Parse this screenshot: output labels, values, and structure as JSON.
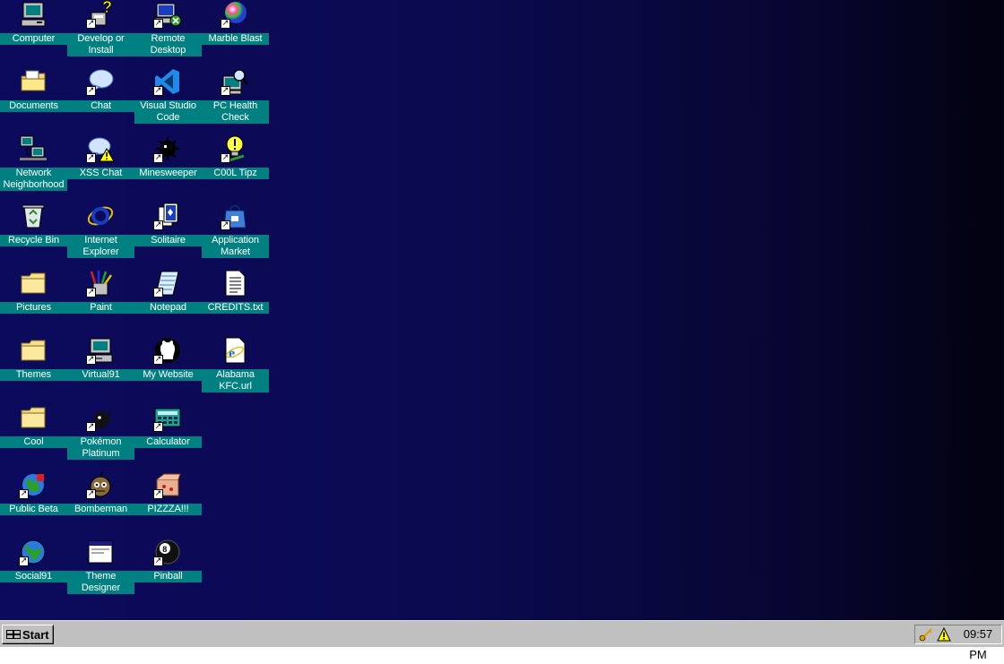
{
  "desktop": {
    "icons": [
      {
        "label": "Computer",
        "icon": "computer-icon",
        "shortcut": false
      },
      {
        "label": "Develop or Install",
        "icon": "develop-install-icon",
        "shortcut": true
      },
      {
        "label": "Remote Desktop",
        "icon": "remote-desktop-icon",
        "shortcut": true
      },
      {
        "label": "Marble Blast",
        "icon": "marble-icon",
        "shortcut": true
      },
      {
        "label": "Documents",
        "icon": "documents-folder-icon",
        "shortcut": false
      },
      {
        "label": "Chat",
        "icon": "chat-bubble-icon",
        "shortcut": true
      },
      {
        "label": "Visual Studio Code",
        "icon": "vscode-icon",
        "shortcut": true
      },
      {
        "label": "PC Health Check",
        "icon": "pc-health-icon",
        "shortcut": true
      },
      {
        "label": "Network Neighborhood",
        "icon": "network-icon",
        "shortcut": false
      },
      {
        "label": "XSS Chat",
        "icon": "xss-chat-icon",
        "shortcut": true
      },
      {
        "label": "Minesweeper",
        "icon": "mine-icon",
        "shortcut": true
      },
      {
        "label": "C00L Tipz",
        "icon": "tips-icon",
        "shortcut": true
      },
      {
        "label": "Recycle Bin",
        "icon": "recycle-bin-icon",
        "shortcut": false
      },
      {
        "label": "Internet Explorer",
        "icon": "internet-explorer-icon",
        "shortcut": false
      },
      {
        "label": "Solitaire",
        "icon": "solitaire-icon",
        "shortcut": true
      },
      {
        "label": "Application Market",
        "icon": "app-market-icon",
        "shortcut": true
      },
      {
        "label": "Pictures",
        "icon": "folder-icon",
        "shortcut": false
      },
      {
        "label": "Paint",
        "icon": "paint-icon",
        "shortcut": true
      },
      {
        "label": "Notepad",
        "icon": "notepad-icon",
        "shortcut": true
      },
      {
        "label": "CREDITS.txt",
        "icon": "text-file-icon",
        "shortcut": false
      },
      {
        "label": "Themes",
        "icon": "folder-icon",
        "shortcut": false
      },
      {
        "label": "Virtual91",
        "icon": "virtual-computer-icon",
        "shortcut": true
      },
      {
        "label": "My Website",
        "icon": "github-icon",
        "shortcut": true
      },
      {
        "label": "Alabama KFC.url",
        "icon": "url-file-icon",
        "shortcut": false
      },
      {
        "label": "Cool",
        "icon": "folder-icon",
        "shortcut": false
      },
      {
        "label": "Pokémon Platinum",
        "icon": "pokemon-icon",
        "shortcut": true
      },
      {
        "label": "Calculator",
        "icon": "calculator-icon",
        "shortcut": true
      },
      null,
      {
        "label": "Public Beta",
        "icon": "public-beta-icon",
        "shortcut": true
      },
      {
        "label": "Bomberman",
        "icon": "bomberman-icon",
        "shortcut": true
      },
      {
        "label": "PIZZZA!!!",
        "icon": "pizza-icon",
        "shortcut": true
      },
      null,
      {
        "label": "Social91",
        "icon": "globe-icon",
        "shortcut": true
      },
      {
        "label": "Theme Designer",
        "icon": "window-icon",
        "shortcut": false
      },
      {
        "label": "Pinball",
        "icon": "eight-ball-icon",
        "shortcut": true
      },
      null
    ]
  },
  "taskbar": {
    "start_label": "Start",
    "tray_icons": [
      "key-icon",
      "warning-icon"
    ],
    "clock_time": "09:57",
    "clock_ampm": "PM"
  }
}
